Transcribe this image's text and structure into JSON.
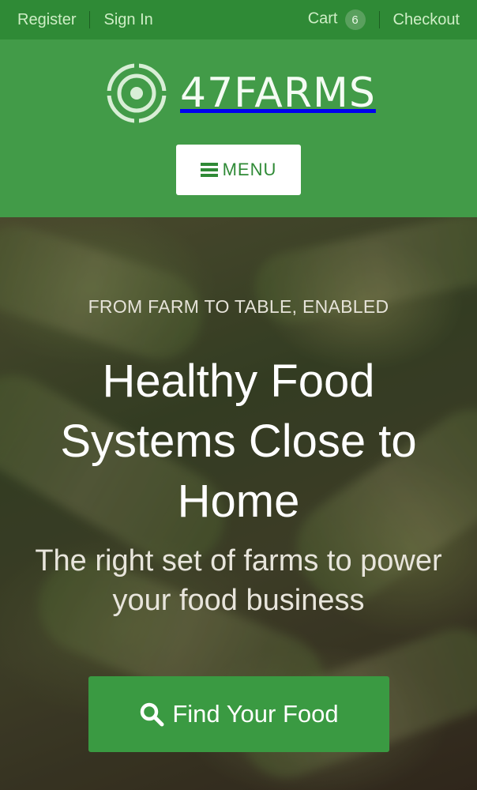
{
  "topbar": {
    "register_label": "Register",
    "signin_label": "Sign In",
    "cart_label": "Cart",
    "cart_count": "6",
    "checkout_label": "Checkout"
  },
  "header": {
    "logo_text": "47FARMS",
    "menu_label": "MENU"
  },
  "hero": {
    "eyebrow": "FROM FARM TO TABLE, ENABLED",
    "headline": "Healthy Food Systems Close to Home",
    "subhead": "The right set of farms to power your food business",
    "cta_label": "Find Your Food",
    "cta_icon": "search-icon"
  },
  "colors": {
    "topbar_bg": "#2f8a36",
    "header_bg": "#429b48",
    "cta_bg": "#3a9a42"
  }
}
